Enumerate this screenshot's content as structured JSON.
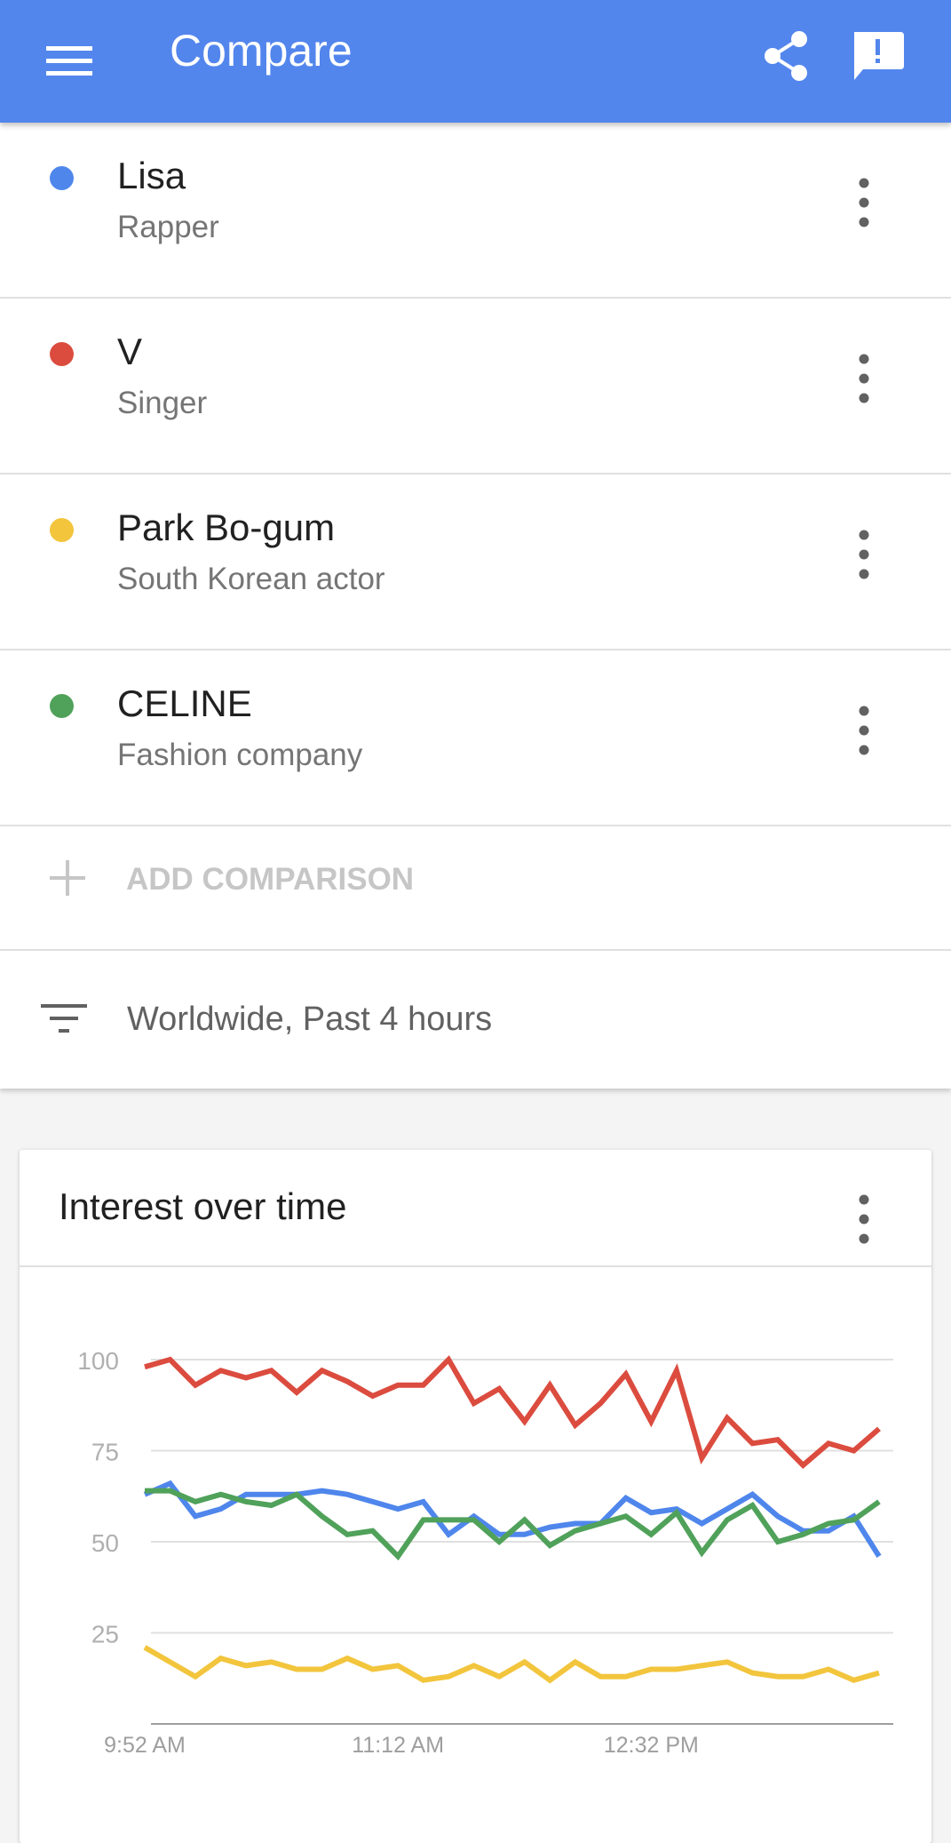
{
  "appbar": {
    "title": "Compare",
    "color": "#5386ed"
  },
  "terms": [
    {
      "name": "Lisa",
      "sub": "Rapper",
      "color": "#4f86ec"
    },
    {
      "name": "V",
      "sub": "Singer",
      "color": "#db4c3f"
    },
    {
      "name": "Park Bo-gum",
      "sub": "South Korean actor",
      "color": "#f2c53d"
    },
    {
      "name": "CELINE",
      "sub": "Fashion company",
      "color": "#50a15a"
    }
  ],
  "add_comparison": {
    "label": "ADD COMPARISON"
  },
  "filter": {
    "label": "Worldwide, Past 4 hours"
  },
  "card": {
    "title": "Interest over time"
  },
  "chart_data": {
    "type": "line",
    "title": "Interest over time",
    "xlabel": "",
    "ylabel": "",
    "ylim": [
      0,
      100
    ],
    "yticks": [
      25,
      50,
      75,
      100
    ],
    "xticks": [
      "9:52 AM",
      "11:12 AM",
      "12:32 PM"
    ],
    "xtick_index": [
      0,
      10,
      20
    ],
    "grid": true,
    "series": [
      {
        "name": "V",
        "color": "#db4c3f",
        "values": [
          98,
          100,
          93,
          97,
          95,
          97,
          91,
          97,
          94,
          90,
          93,
          93,
          100,
          88,
          92,
          83,
          93,
          82,
          88,
          96,
          83,
          97,
          73,
          84,
          77,
          78,
          71,
          77,
          75,
          81
        ]
      },
      {
        "name": "Lisa",
        "color": "#4f86ec",
        "values": [
          63,
          66,
          57,
          59,
          63,
          63,
          63,
          64,
          63,
          61,
          59,
          61,
          52,
          57,
          52,
          52,
          54,
          55,
          55,
          62,
          58,
          59,
          55,
          59,
          63,
          57,
          53,
          53,
          57,
          46
        ]
      },
      {
        "name": "CELINE",
        "color": "#50a15a",
        "values": [
          64,
          64,
          61,
          63,
          61,
          60,
          63,
          57,
          52,
          53,
          46,
          56,
          56,
          56,
          50,
          56,
          49,
          53,
          55,
          57,
          52,
          58,
          47,
          56,
          60,
          50,
          52,
          55,
          56,
          61
        ]
      },
      {
        "name": "Park Bo-gum",
        "color": "#f2c53d",
        "values": [
          21,
          17,
          13,
          18,
          16,
          17,
          15,
          15,
          18,
          15,
          16,
          12,
          13,
          16,
          13,
          17,
          12,
          17,
          13,
          13,
          15,
          15,
          16,
          17,
          14,
          13,
          13,
          15,
          12,
          14
        ]
      }
    ]
  }
}
